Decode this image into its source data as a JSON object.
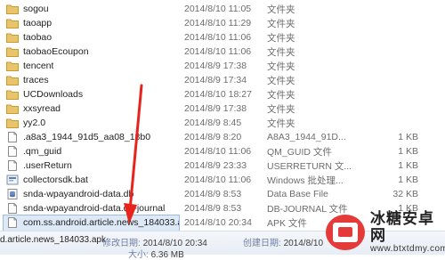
{
  "files": [
    {
      "name": "sogou",
      "date": "2014/8/10 11:05",
      "type": "文件夹",
      "size": "",
      "icon": "folder-icon"
    },
    {
      "name": "taoapp",
      "date": "2014/8/10 11:29",
      "type": "文件夹",
      "size": "",
      "icon": "folder-icon"
    },
    {
      "name": "taobao",
      "date": "2014/8/10 11:06",
      "type": "文件夹",
      "size": "",
      "icon": "folder-icon"
    },
    {
      "name": "taobaoEcoupon",
      "date": "2014/8/10 11:06",
      "type": "文件夹",
      "size": "",
      "icon": "folder-icon"
    },
    {
      "name": "tencent",
      "date": "2014/8/9 17:38",
      "type": "文件夹",
      "size": "",
      "icon": "folder-icon"
    },
    {
      "name": "traces",
      "date": "2014/8/9 17:34",
      "type": "文件夹",
      "size": "",
      "icon": "folder-icon"
    },
    {
      "name": "UCDownloads",
      "date": "2014/8/10 18:27",
      "type": "文件夹",
      "size": "",
      "icon": "folder-icon"
    },
    {
      "name": "xxsyread",
      "date": "2014/8/9 17:38",
      "type": "文件夹",
      "size": "",
      "icon": "folder-icon"
    },
    {
      "name": "yy2.0",
      "date": "2014/8/9 8:45",
      "type": "文件夹",
      "size": "",
      "icon": "folder-icon"
    },
    {
      "name": ".a8a3_1944_91d5_aa08_18b0",
      "date": "2014/8/9 8:20",
      "type": "A8A3_1944_91D...",
      "size": "1 KB",
      "icon": "file-icon"
    },
    {
      "name": ".qm_guid",
      "date": "2014/8/10 11:06",
      "type": "QM_GUID 文件",
      "size": "1 KB",
      "icon": "file-icon"
    },
    {
      "name": ".userReturn",
      "date": "2014/8/9 23:33",
      "type": "USERRETURN 文...",
      "size": "1 KB",
      "icon": "file-icon"
    },
    {
      "name": "collectorsdk.bat",
      "date": "2014/8/10 11:06",
      "type": "Windows 批处理...",
      "size": "1 KB",
      "icon": "bat-file-icon"
    },
    {
      "name": "snda-wpayandroid-data.db",
      "date": "2014/8/9 8:53",
      "type": "Data Base File",
      "size": "32 KB",
      "icon": "db-file-icon"
    },
    {
      "name": "snda-wpayandroid-data.db-journal",
      "date": "2014/8/9 8:53",
      "type": "DB-JOURNAL 文件",
      "size": "1 KB",
      "icon": "file-icon"
    },
    {
      "name": "com.ss.android.article.news_184033.a...",
      "date": "2014/8/10 20:34",
      "type": "APK 文件",
      "size": "",
      "icon": "file-icon"
    }
  ],
  "status_bar": {
    "filename": "d.article.news_184033.apk",
    "modified_label": "修改日期:",
    "modified_value": "2014/8/10 20:34",
    "created_label": "创建日期:",
    "created_value": "2014/8/10",
    "size_label": "大小:",
    "size_value": "6.36 MB"
  },
  "watermark": {
    "title": "冰糖安卓网",
    "url": "www.btxtdmy.com"
  },
  "colors": {
    "selection": "#dde9f7",
    "folder": "#e9c46a",
    "arrow": "#e8231c",
    "watermark_red": "#e53a3a"
  }
}
